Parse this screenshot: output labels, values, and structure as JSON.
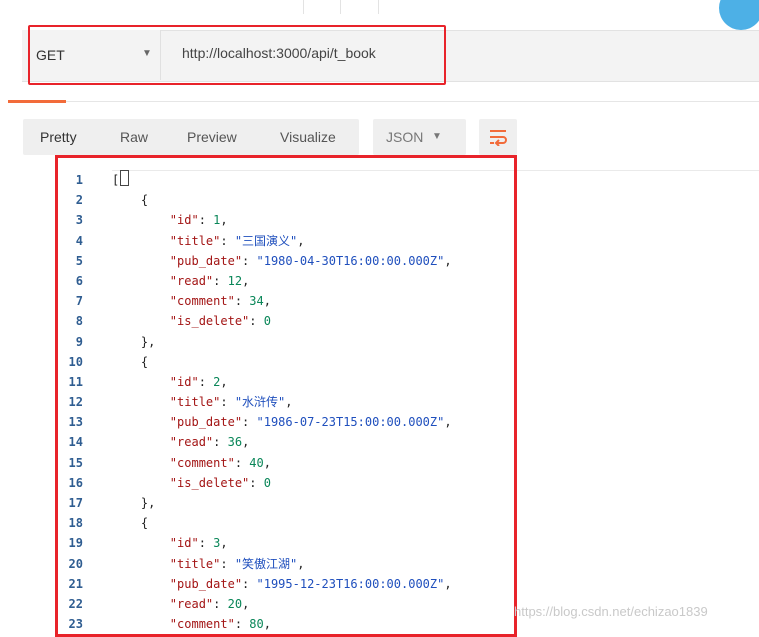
{
  "request": {
    "method": "GET",
    "url": "http://localhost:3000/api/t_book"
  },
  "response_tabs": [
    "Pretty",
    "Raw",
    "Preview",
    "Visualize"
  ],
  "format": "JSON",
  "code_lines": [
    "[",
    "    {",
    "        \"id\": 1,",
    "        \"title\": \"三国演义\",",
    "        \"pub_date\": \"1980-04-30T16:00:00.000Z\",",
    "        \"read\": 12,",
    "        \"comment\": 34,",
    "        \"is_delete\": 0",
    "    },",
    "    {",
    "        \"id\": 2,",
    "        \"title\": \"水浒传\",",
    "        \"pub_date\": \"1986-07-23T15:00:00.000Z\",",
    "        \"read\": 36,",
    "        \"comment\": 40,",
    "        \"is_delete\": 0",
    "    },",
    "    {",
    "        \"id\": 3,",
    "        \"title\": \"笑傲江湖\",",
    "        \"pub_date\": \"1995-12-23T16:00:00.000Z\",",
    "        \"read\": 20,",
    "        \"comment\": 80,"
  ],
  "line_numbers": [
    "1",
    "2",
    "3",
    "4",
    "5",
    "6",
    "7",
    "8",
    "9",
    "10",
    "11",
    "12",
    "13",
    "14",
    "15",
    "16",
    "17",
    "18",
    "19",
    "20",
    "21",
    "22",
    "23"
  ],
  "watermark": "https://blog.csdn.net/echizao1839",
  "colors": {
    "highlight_border": "#e8232a",
    "active_tab_accent": "#f26b3a",
    "json_key": "#a31515",
    "json_string": "#1f4fbd",
    "json_number": "#098658",
    "line_number": "#2f5d91"
  }
}
